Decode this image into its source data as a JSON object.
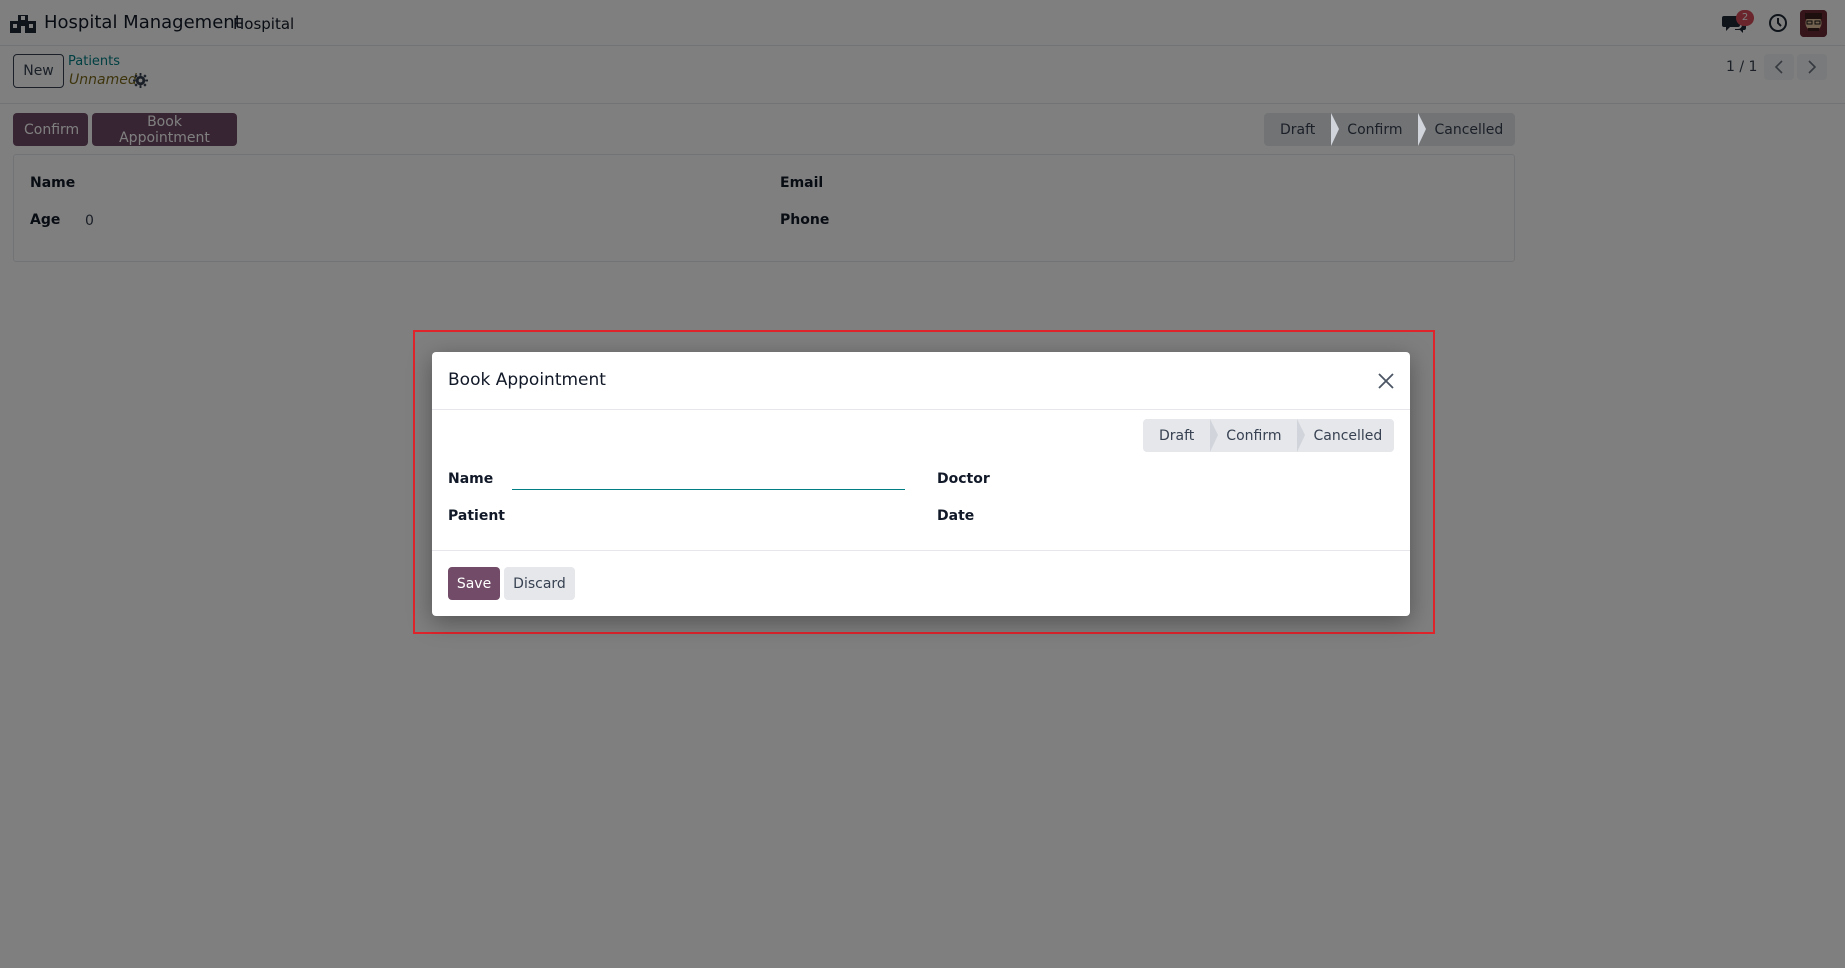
{
  "navbar": {
    "app_name": "Hospital Management",
    "menu_item": "Hospital",
    "chat_badge_count": "2"
  },
  "control_panel": {
    "new_button": "New",
    "breadcrumb_parent": "Patients",
    "breadcrumb_current": "Unnamed",
    "pager_value": "1 / 1"
  },
  "form": {
    "buttons": {
      "confirm": "Confirm",
      "book_appointment": "Book Appointment"
    },
    "status_stages": [
      "Draft",
      "Confirm",
      "Cancelled"
    ],
    "fields": {
      "name_label": "Name",
      "age_label": "Age",
      "age_value": "0",
      "email_label": "Email",
      "phone_label": "Phone"
    }
  },
  "dialog": {
    "title": "Book Appointment",
    "status_stages": [
      "Draft",
      "Confirm",
      "Cancelled"
    ],
    "fields": {
      "name_label": "Name",
      "name_value": "",
      "patient_label": "Patient",
      "doctor_label": "Doctor",
      "date_label": "Date"
    },
    "save_button": "Save",
    "discard_button": "Discard"
  },
  "colors": {
    "primary": "#714b67",
    "link": "#017e84",
    "highlight": "#e0242c",
    "badge": "#d44c59"
  },
  "icons": [
    "app-icon",
    "chat-icon",
    "clock-icon",
    "gear-icon",
    "chevron-left-icon",
    "chevron-right-icon",
    "close-icon"
  ]
}
